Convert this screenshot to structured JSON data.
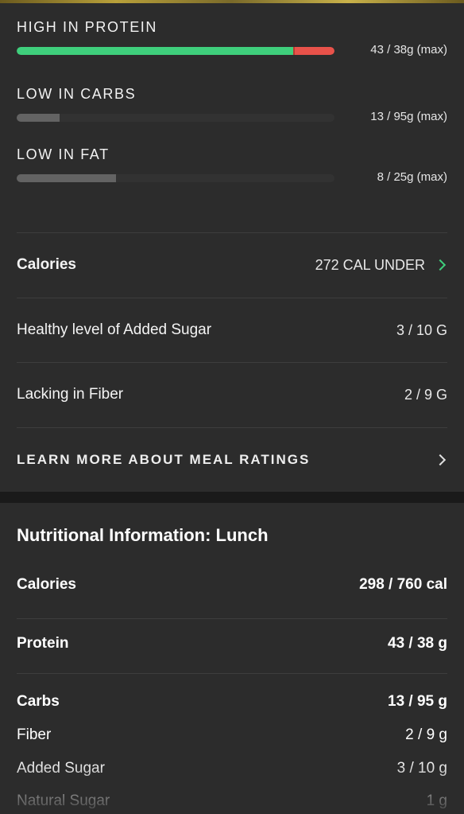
{
  "macros": [
    {
      "label": "HIGH IN PROTEIN",
      "value": "43 / 38g (max)",
      "progress": 1.0,
      "over": true
    },
    {
      "label": "LOW IN CARBS",
      "value": "13 / 95g (max)",
      "progress": 0.137
    },
    {
      "label": "LOW IN FAT",
      "value": "8 / 25g (max)",
      "progress": 0.32
    }
  ],
  "ratings": {
    "calories": {
      "label": "Calories",
      "value": "272 CAL UNDER"
    },
    "added_sugar": {
      "label": "Healthy level of Added Sugar",
      "value": "3 / 10 G"
    },
    "fiber": {
      "label": "Lacking in Fiber",
      "value": "2 / 9 G"
    },
    "learn_more": "LEARN MORE ABOUT MEAL RATINGS"
  },
  "nutrition": {
    "title": "Nutritional Information: Lunch",
    "rows": [
      {
        "label": "Calories",
        "value": "298 / 760 cal"
      },
      {
        "label": "Protein",
        "value": "43 / 38 g"
      },
      {
        "label": "Carbs",
        "value": "13 / 95 g"
      },
      {
        "label": "Fiber",
        "value": "2 / 9 g"
      },
      {
        "label": "Added Sugar",
        "value": "3 / 10 g"
      },
      {
        "label": "Natural Sugar",
        "value": "1 g"
      }
    ]
  },
  "colors": {
    "green": "#3fcf7c",
    "red": "#e8524a",
    "gray_bar": "#636363",
    "background": "#2c2c2c"
  }
}
